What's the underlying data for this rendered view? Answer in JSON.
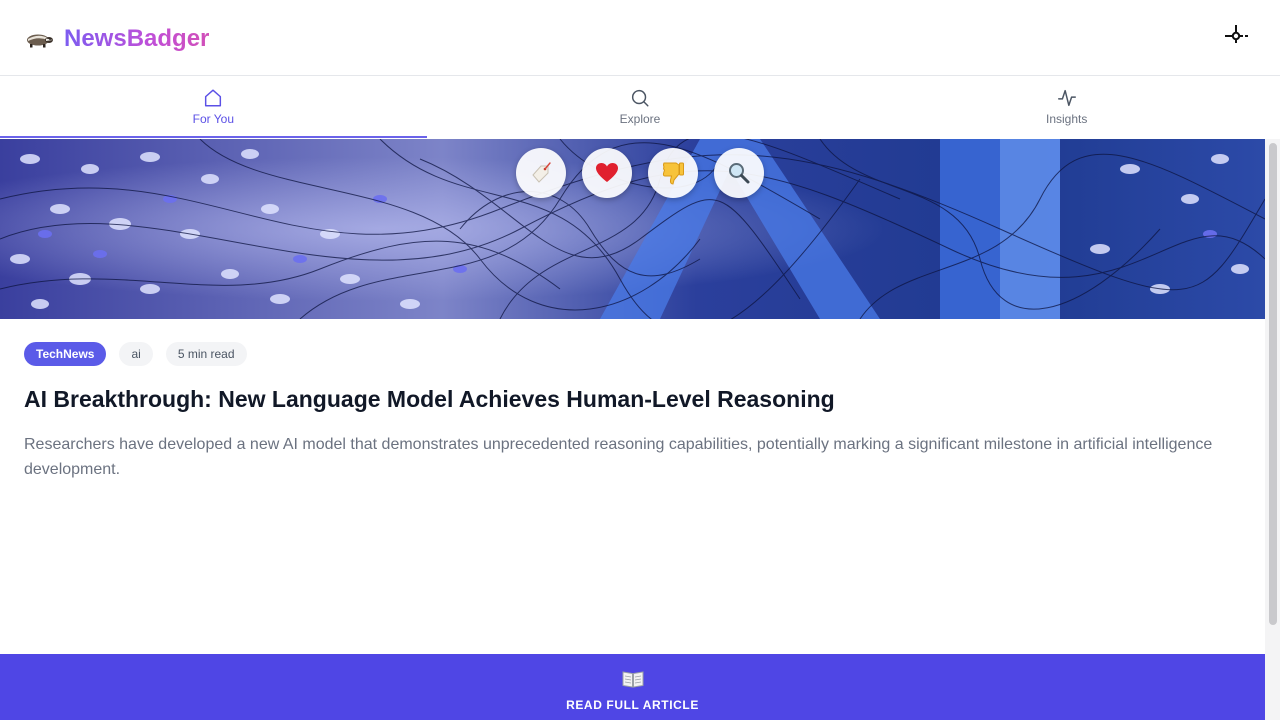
{
  "app": {
    "name": "NewsBadger",
    "logo_icon": "badger-icon",
    "settings_icon": "crosshair-settings-icon"
  },
  "tabs": [
    {
      "label": "For You",
      "icon": "home-icon",
      "active": true
    },
    {
      "label": "Explore",
      "icon": "search-icon",
      "active": false
    },
    {
      "label": "Insights",
      "icon": "activity-icon",
      "active": false
    }
  ],
  "hero": {
    "actions": [
      {
        "name": "tag-action",
        "icon": "tag-icon"
      },
      {
        "name": "like-action",
        "icon": "heart-icon"
      },
      {
        "name": "dislike-action",
        "icon": "thumbs-down-icon"
      },
      {
        "name": "search-action",
        "icon": "magnifier-icon"
      }
    ]
  },
  "article": {
    "source": "TechNews",
    "topic": "ai",
    "read_time": "5 min read",
    "title": "AI Breakthrough: New Language Model Achieves Human-Level Reasoning",
    "summary": "Researchers have developed a new AI model that demonstrates unprecedented reasoning capabilities, potentially marking a significant milestone in artificial intelligence development."
  },
  "cta": {
    "label": "READ FULL ARTICLE",
    "icon": "open-book-icon"
  },
  "colors": {
    "accent": "#4f46e5",
    "tab_active": "#5b50e6",
    "source_chip": "#5b5be8",
    "brand_gradient_start": "#7c5cf0",
    "brand_gradient_end": "#d14fb8"
  }
}
